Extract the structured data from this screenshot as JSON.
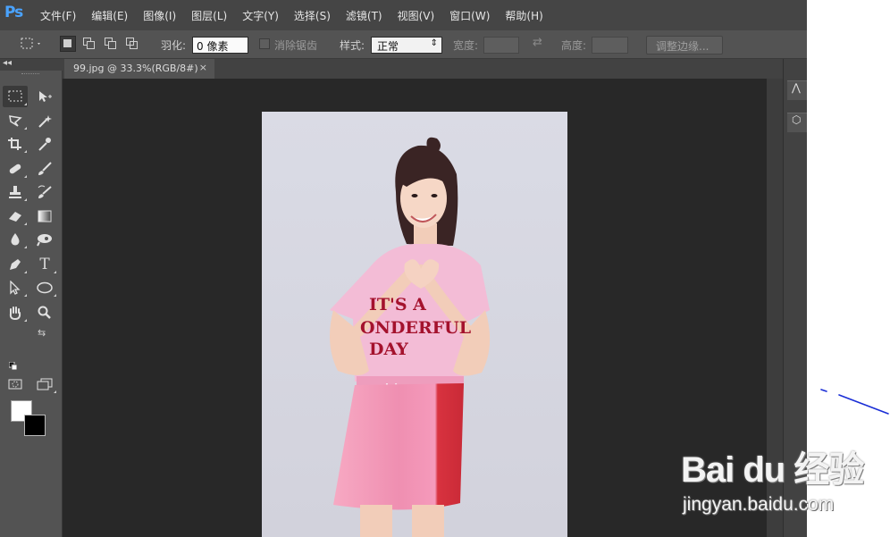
{
  "app": {
    "logo": "Ps"
  },
  "menu": {
    "items": [
      "文件(F)",
      "编辑(E)",
      "图像(I)",
      "图层(L)",
      "文字(Y)",
      "选择(S)",
      "滤镜(T)",
      "视图(V)",
      "窗口(W)",
      "帮助(H)"
    ]
  },
  "options": {
    "feather_label": "羽化:",
    "feather_value": "0 像素",
    "antialias_label": "消除锯齿",
    "style_label": "样式:",
    "style_value": "正常",
    "width_label": "宽度:",
    "height_label": "高度:",
    "refine_edge_label": "调整边缘..."
  },
  "document": {
    "tab_title": "99.jpg @ 33.3%(RGB/8#)",
    "tab_close": "×",
    "photo_text": "IT'S A\nONDERFUL\nDAY"
  },
  "toolbar": {
    "text_tool_glyph": "T",
    "foreground_color": "#ffffff",
    "background_color": "#000000"
  },
  "colors": {
    "menubar": "#454545",
    "workspace": "#535353",
    "canvas_bg": "#282828",
    "ps_blue": "#4aa3ff"
  },
  "watermark": {
    "logo_text": "Bai du 经验",
    "url": "jingyan.baidu.com"
  }
}
